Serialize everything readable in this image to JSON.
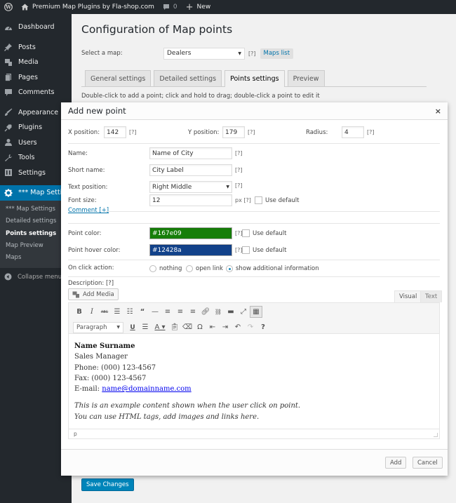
{
  "admin_bar": {
    "site_name": "Premium Map Plugins by Fla-shop.com",
    "comments_count": "0",
    "new_label": "New"
  },
  "sidebar": {
    "items": [
      {
        "label": "Dashboard",
        "icon": "dashboard-icon"
      },
      {
        "label": "Posts",
        "icon": "pin-icon"
      },
      {
        "label": "Media",
        "icon": "media-icon"
      },
      {
        "label": "Pages",
        "icon": "pages-icon"
      },
      {
        "label": "Comments",
        "icon": "comment-icon"
      },
      {
        "label": "Appearance",
        "icon": "brush-icon"
      },
      {
        "label": "Plugins",
        "icon": "plugin-icon"
      },
      {
        "label": "Users",
        "icon": "user-icon"
      },
      {
        "label": "Tools",
        "icon": "wrench-icon"
      },
      {
        "label": "Settings",
        "icon": "settings-icon"
      },
      {
        "label": "*** Map Settin",
        "icon": "gear-icon"
      }
    ],
    "submenu": [
      "*** Map Settings",
      "Detailed settings",
      "Points settings",
      "Map Preview",
      "Maps"
    ],
    "submenu_current": "Points settings",
    "collapse_label": "Collapse menu"
  },
  "page": {
    "title": "Configuration of Map points",
    "select_label": "Select a map:",
    "selected_map": "Dealers",
    "help": "[?]",
    "maps_list_label": "Maps list",
    "tabs": [
      "General settings",
      "Detailed settings",
      "Points settings",
      "Preview"
    ],
    "active_tab": "Points settings",
    "hint": "Double-click to add a point; click and hold to drag; double-click a point to edit it",
    "save_label": "Save Changes"
  },
  "dialog": {
    "title": "Add new point",
    "close": "×",
    "x_label": "X position:",
    "x_value": "142",
    "y_label": "Y position:",
    "y_value": "179",
    "radius_label": "Radius:",
    "radius_value": "4",
    "name_label": "Name:",
    "name_value": "Name of City",
    "short_label": "Short name:",
    "short_value": "City Label",
    "textpos_label": "Text position:",
    "textpos_value": "Right Middle",
    "fontsize_label": "Font size:",
    "fontsize_value": "12",
    "px_label": "px [?]",
    "use_default": "Use default",
    "comment_link": "Comment [+]",
    "point_color_label": "Point color:",
    "point_color": "#167e09",
    "hover_color_label": "Point hover color:",
    "hover_color": "#12428a",
    "click_label": "On click action:",
    "click_options": [
      "nothing",
      "open link",
      "show additional information"
    ],
    "click_selected": "show additional information",
    "description_label": "Description: [?]",
    "add_media": "Add Media",
    "editor_tabs": [
      "Visual",
      "Text"
    ],
    "editor_active_tab": "Visual",
    "format_select": "Paragraph",
    "toolbar_row1": [
      "bold-icon",
      "italic-icon",
      "strikethrough-icon",
      "bullet-list-icon",
      "numbered-list-icon",
      "blockquote-icon",
      "horizontal-rule-icon",
      "align-left-icon",
      "align-center-icon",
      "align-right-icon",
      "link-icon",
      "unlink-icon",
      "read-more-icon",
      "fullscreen-icon",
      "toolbar-toggle-icon"
    ],
    "toolbar_row2": [
      "underline-icon",
      "justify-icon",
      "text-color-icon",
      "paste-text-icon",
      "clear-format-icon",
      "special-char-icon",
      "outdent-icon",
      "indent-icon",
      "undo-icon",
      "redo-icon",
      "help-icon"
    ],
    "content": {
      "name": "Name Surname",
      "role": "Sales Manager",
      "phone": "Phone: (000) 123-4567",
      "fax": "Fax: (000) 123-4567",
      "email_prefix": "E-mail: ",
      "email": "name@domainname.com",
      "note1": "This is an example content shown when the user click on point.",
      "note2": "You can use HTML tags, add images and links here."
    },
    "status_path": "p",
    "add_label": "Add",
    "cancel_label": "Cancel"
  }
}
